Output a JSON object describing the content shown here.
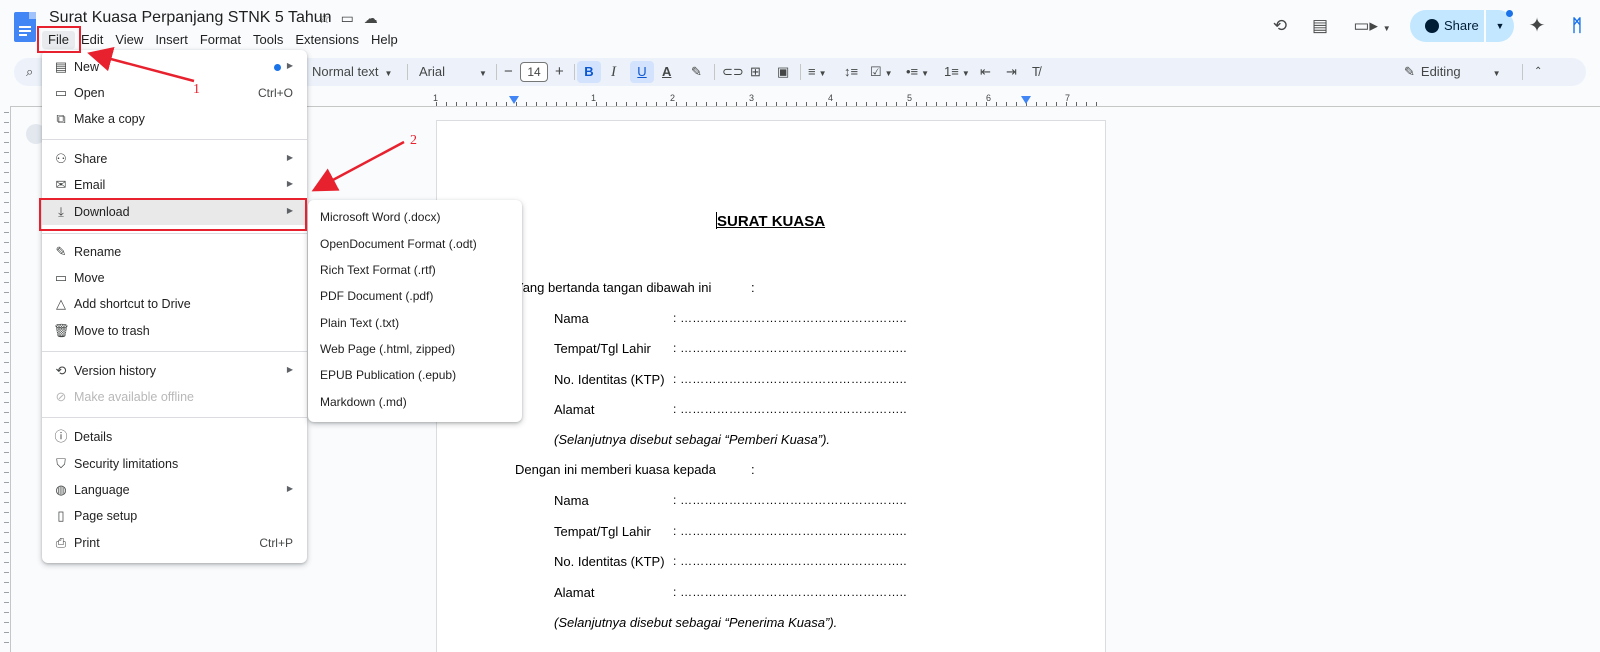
{
  "window": {
    "title": "Surat Kuasa Perpanjang STNK 5 Tahun"
  },
  "menubar": [
    "File",
    "Edit",
    "View",
    "Insert",
    "Format",
    "Tools",
    "Extensions",
    "Help"
  ],
  "header_actions": {
    "share_label": "Share"
  },
  "toolbar": {
    "style": "Normal text",
    "font": "Arial",
    "font_size": "14",
    "bold": "B",
    "italic": "I",
    "underline": "U",
    "text_color": "A",
    "mode": "Editing"
  },
  "ruler": {
    "numbers": [
      "1",
      "1",
      "2",
      "3",
      "4",
      "5",
      "6",
      "7"
    ]
  },
  "file_menu": {
    "items": [
      {
        "label": "New",
        "icon": "document-icon",
        "submenu": true
      },
      {
        "label": "Open",
        "icon": "folder-icon",
        "shortcut": "Ctrl+O"
      },
      {
        "label": "Make a copy",
        "icon": "copy-icon"
      },
      {
        "label": "Share",
        "icon": "person-add-icon",
        "submenu": true
      },
      {
        "label": "Email",
        "icon": "mail-icon",
        "submenu": true
      },
      {
        "label": "Download",
        "icon": "download-icon",
        "submenu": true
      },
      {
        "label": "Rename",
        "icon": "pencil-icon"
      },
      {
        "label": "Move",
        "icon": "folder-move-icon"
      },
      {
        "label": "Add shortcut to Drive",
        "icon": "drive-shortcut-icon"
      },
      {
        "label": "Move to trash",
        "icon": "trash-icon"
      },
      {
        "label": "Version history",
        "icon": "history-icon",
        "submenu": true
      },
      {
        "label": "Make available offline",
        "icon": "offline-icon",
        "disabled": true
      },
      {
        "label": "Details",
        "icon": "info-icon"
      },
      {
        "label": "Security limitations",
        "icon": "shield-icon"
      },
      {
        "label": "Language",
        "icon": "globe-icon",
        "submenu": true
      },
      {
        "label": "Page setup",
        "icon": "page-setup-icon"
      },
      {
        "label": "Print",
        "icon": "print-icon",
        "shortcut": "Ctrl+P"
      }
    ]
  },
  "download_submenu": [
    "Microsoft Word (.docx)",
    "OpenDocument Format (.odt)",
    "Rich Text Format (.rtf)",
    "PDF Document (.pdf)",
    "Plain Text (.txt)",
    "Web Page (.html, zipped)",
    "EPUB Publication (.epub)",
    "Markdown (.md)"
  ],
  "document": {
    "title": "SURAT KUASA",
    "intro1": "Yang bertanda tangan dibawah ini",
    "intro2": "Dengan ini memberi kuasa kepada",
    "colon": ":",
    "fields": [
      "Nama",
      "Tempat/Tgl Lahir",
      "No. Identitas (KTP)",
      "Alamat"
    ],
    "dots": ": ………………………………………………..",
    "note1": "(Selanjutnya disebut sebagai “Pemberi Kuasa”).",
    "note2": "(Selanjutnya disebut sebagai “Penerima Kuasa”)."
  },
  "annotations": {
    "step1": "1",
    "step2": "2",
    "color": "#e8212e"
  }
}
